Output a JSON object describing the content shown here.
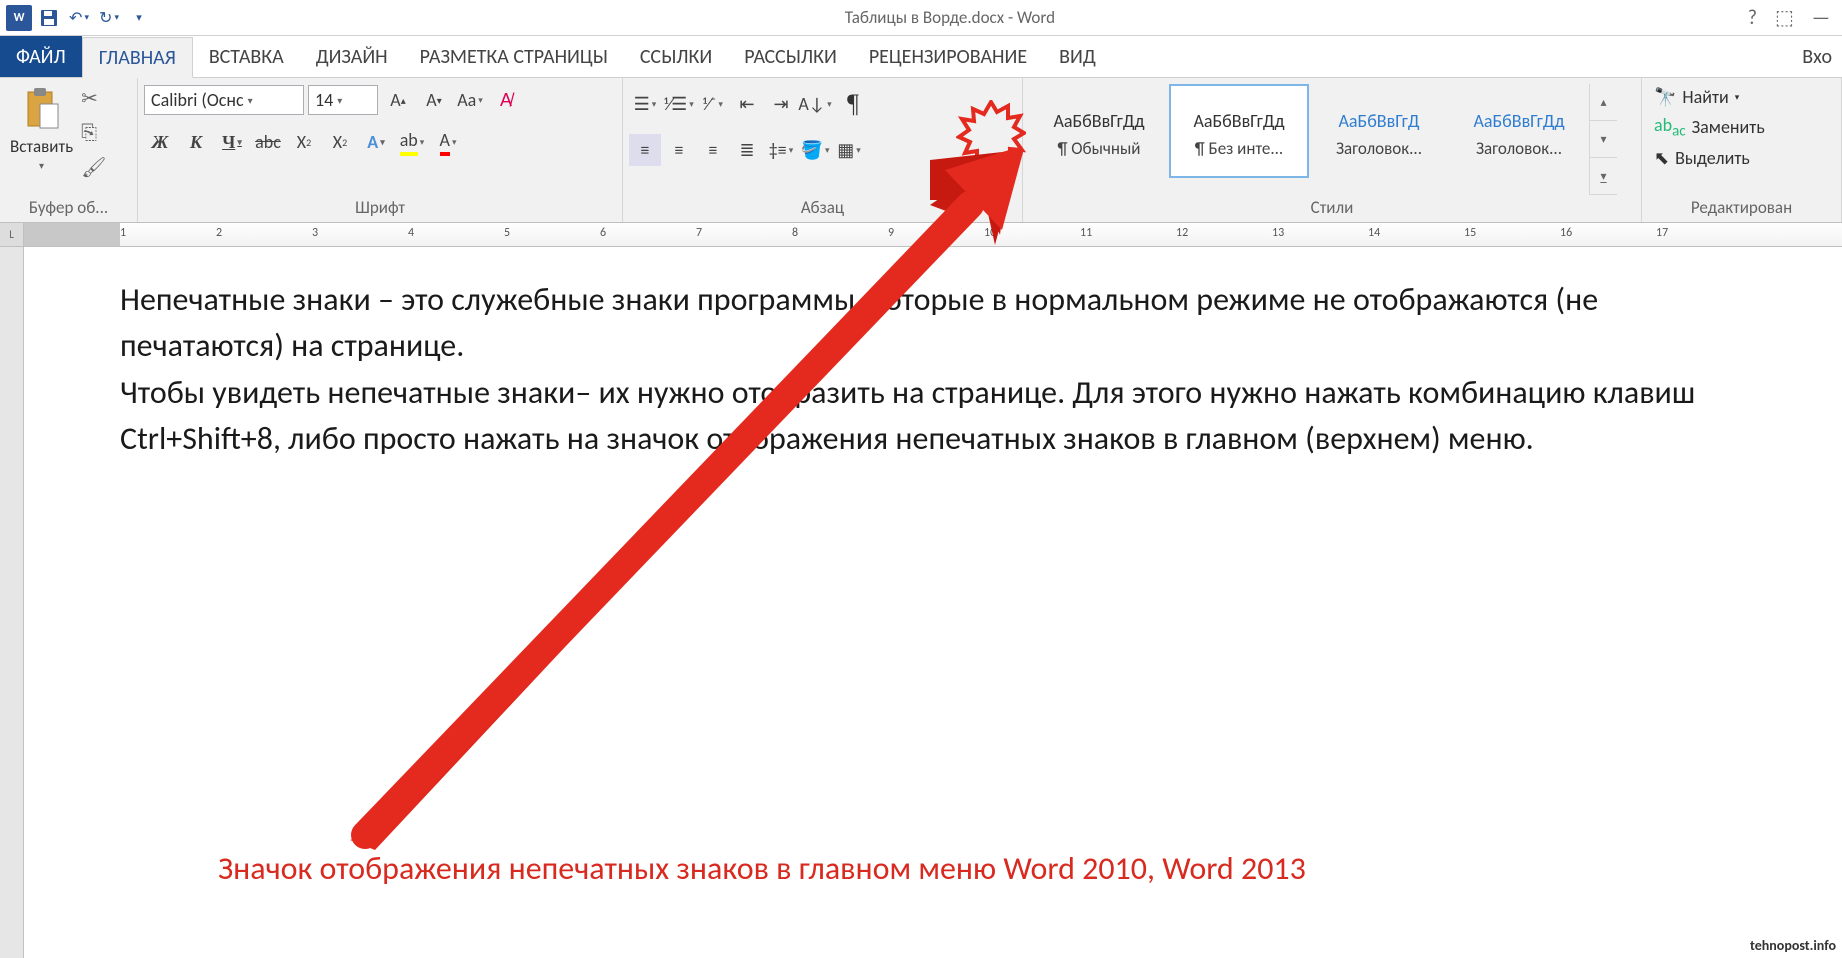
{
  "titlebar": {
    "title": "Таблицы в Ворде.docx - Word",
    "qat": {
      "save": "save",
      "undo": "undo",
      "redo": "redo"
    }
  },
  "tabs": {
    "file": "ФАЙЛ",
    "home": "ГЛАВНАЯ",
    "insert": "ВСТАВКА",
    "design": "ДИЗАЙН",
    "layout": "РАЗМЕТКА СТРАНИЦЫ",
    "references": "ССЫЛКИ",
    "mailings": "РАССЫЛКИ",
    "review": "РЕЦЕНЗИРОВАНИЕ",
    "view": "ВИД",
    "signin": "Вхо"
  },
  "clipboard": {
    "paste": "Вставить",
    "label": "Буфер об..."
  },
  "font": {
    "name": "Calibri (Оснс",
    "size": "14",
    "label": "Шрифт"
  },
  "paragraph": {
    "label": "Абзац"
  },
  "styles": {
    "label": "Стили",
    "items": [
      {
        "sample": "АаБбВвГгДд",
        "name": "¶ Обычный",
        "blue": false
      },
      {
        "sample": "АаБбВвГгДд",
        "name": "¶ Без инте...",
        "blue": false
      },
      {
        "sample": "АаБбВвГгД",
        "name": "Заголовок...",
        "blue": true
      },
      {
        "sample": "АаБбВвГгДд",
        "name": "Заголовок...",
        "blue": true
      }
    ]
  },
  "editing": {
    "find": "Найти",
    "replace": "Заменить",
    "select": "Выделить",
    "label": "Редактирован"
  },
  "ruler": [
    "1",
    "2",
    "3",
    "4",
    "5",
    "6",
    "7",
    "8",
    "9",
    "10",
    "11",
    "12",
    "13",
    "14",
    "15",
    "16",
    "17"
  ],
  "document": {
    "p1": "Непечатные знаки – это служебные знаки программы, которые в нормальном режиме не отображаются (не печатаются) на странице.",
    "p2": "Чтобы увидеть непечатные знаки– их нужно отобразить на странице. Для этого нужно нажать комбинацию клавиш Ctrl+Shift+8, либо просто нажать на значок отображения непечатных знаков в главном (верхнем) меню."
  },
  "caption": "Значок отображения непечатных знаков в главном меню Word 2010, Word   2013",
  "watermark": "tehnopost.info"
}
